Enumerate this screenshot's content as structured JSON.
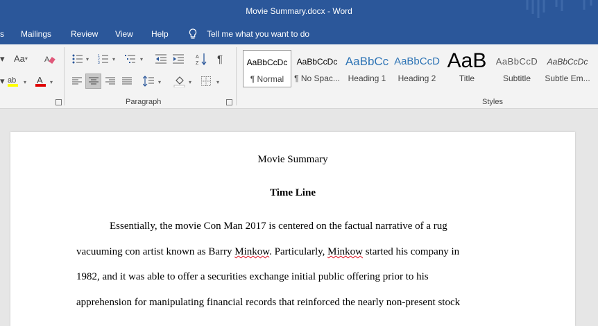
{
  "window": {
    "title": "Movie Summary.docx  -  Word"
  },
  "menu": {
    "items": [
      "s",
      "Mailings",
      "Review",
      "View",
      "Help"
    ],
    "tell_me": "Tell me what you want to do"
  },
  "ribbon": {
    "font_group": {
      "change_case": "Aa"
    },
    "paragraph_label": "Paragraph",
    "styles_label": "Styles",
    "styles": [
      {
        "preview": "AaBbCcDc",
        "label": "¶ Normal",
        "selected": true
      },
      {
        "preview": "AaBbCcDc",
        "label": "¶ No Spac...",
        "selected": false
      },
      {
        "preview": "AaBbCc",
        "label": "Heading 1",
        "selected": false
      },
      {
        "preview": "AaBbCcD",
        "label": "Heading 2",
        "selected": false
      },
      {
        "preview": "AaB",
        "label": "Title",
        "selected": false
      },
      {
        "preview": "AaBbCcD",
        "label": "Subtitle",
        "selected": false
      },
      {
        "preview": "AaBbCcDc",
        "label": "Subtle Em...",
        "selected": false
      }
    ],
    "colors": {
      "highlight": "#ffff00",
      "font_color": "#e00000",
      "accent": "#2b579a"
    }
  },
  "document": {
    "title": "Movie Summary",
    "heading": "Time Line",
    "lines": [
      "Essentially, the movie Con Man 2017 is centered on the factual narrative of a rug",
      "1982, and it was able to offer a securities exchange initial public offering prior to his",
      "apprehension for manipulating financial records that reinforced the nearly non-present stock"
    ],
    "line2": {
      "a": "vacuuming con artist known as Barry ",
      "b": "Minkow",
      "c": ". Particularly, ",
      "d": "Minkow",
      "e": " started his company in"
    }
  }
}
